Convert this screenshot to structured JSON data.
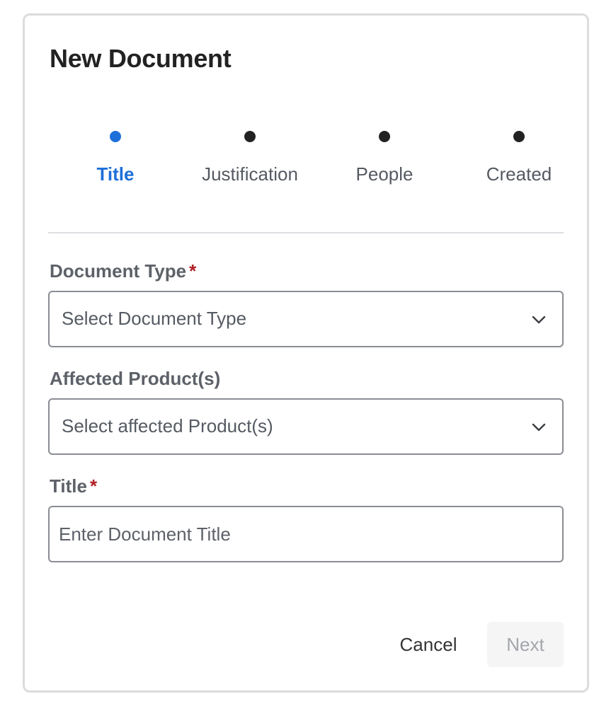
{
  "modal": {
    "title": "New Document"
  },
  "stepper": {
    "steps": [
      {
        "label": "Title",
        "active": true
      },
      {
        "label": "Justification",
        "active": false
      },
      {
        "label": "People",
        "active": false
      },
      {
        "label": "Created",
        "active": false
      }
    ],
    "active_color": "#1e6fd9"
  },
  "form": {
    "document_type": {
      "label": "Document Type",
      "required_mark": "*",
      "selected": "Select Document Type"
    },
    "affected_products": {
      "label": "Affected Product(s)",
      "selected": "Select affected Product(s)"
    },
    "title": {
      "label": "Title",
      "required_mark": "*",
      "value": "",
      "placeholder": "Enter Document Title"
    }
  },
  "actions": {
    "cancel_label": "Cancel",
    "next_label": "Next"
  },
  "icons": {
    "dropdown": "chevron-down-icon"
  }
}
